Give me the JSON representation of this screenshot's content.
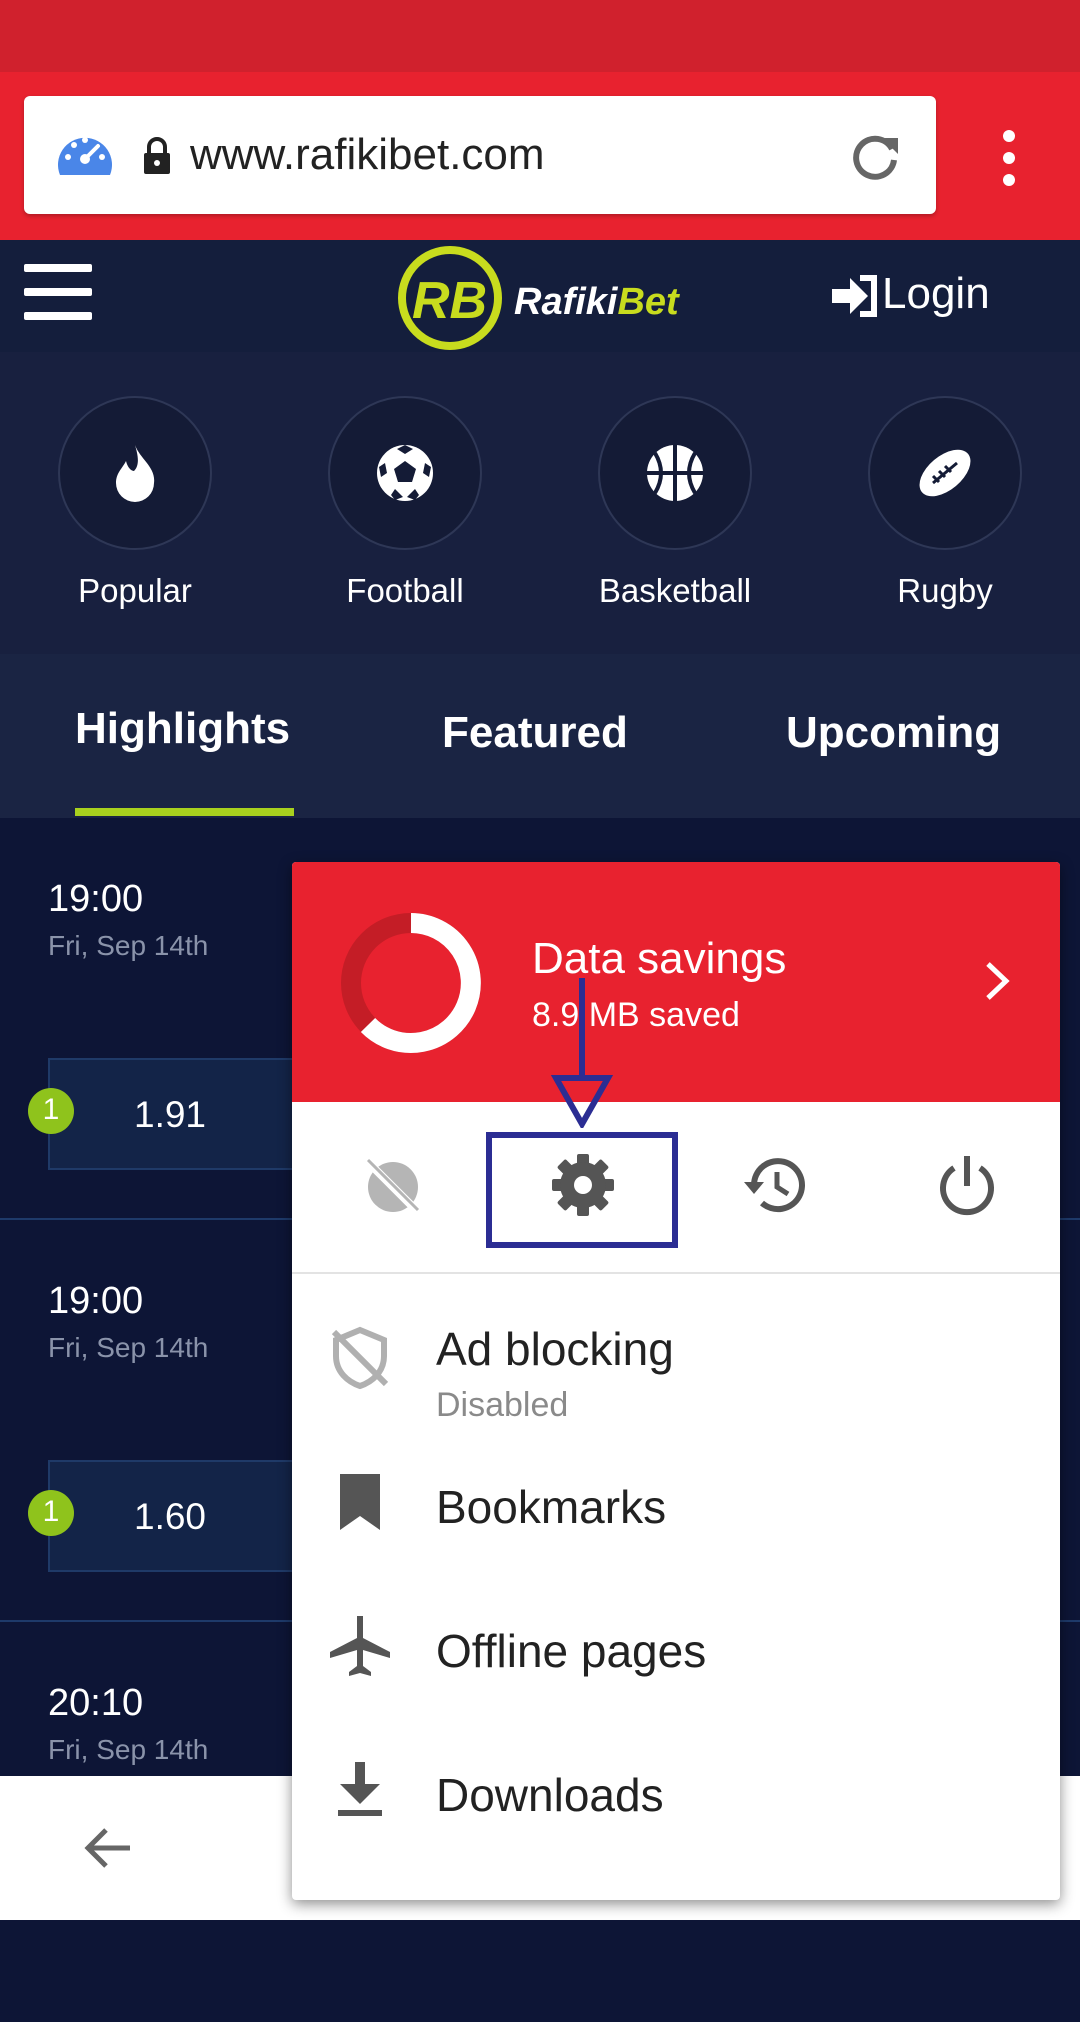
{
  "browser": {
    "url": "www.rafikibet.com",
    "icons": [
      "data-savings-speed-icon",
      "lock-icon",
      "reload-icon",
      "more-options-icon"
    ]
  },
  "site": {
    "brand": "RafikiBet",
    "logo_letters": "RB",
    "login_label": "Login",
    "sports": [
      {
        "label": "Popular",
        "icon": "fire-icon"
      },
      {
        "label": "Football",
        "icon": "football-icon"
      },
      {
        "label": "Basketball",
        "icon": "basketball-icon"
      },
      {
        "label": "Rugby",
        "icon": "rugby-ball-icon"
      }
    ],
    "tabs": [
      {
        "label": "Highlights",
        "active": true
      },
      {
        "label": "Featured",
        "active": false
      },
      {
        "label": "Upcoming",
        "active": false
      }
    ],
    "matches": [
      {
        "time": "19:00",
        "date": "Fri, Sep 14th",
        "badge": "1",
        "odd": "1.91"
      },
      {
        "time": "19:00",
        "date": "Fri, Sep 14th",
        "badge": "1",
        "odd": "1.60"
      },
      {
        "time": "20:10",
        "date": "Fri, Sep 14th"
      }
    ],
    "accent_color": "#a8d11e"
  },
  "menu": {
    "data_savings": {
      "title": "Data savings",
      "subtitle": "8.9 MB saved"
    },
    "icon_row": [
      "incognito-icon",
      "settings-icon",
      "history-icon",
      "power-icon"
    ],
    "items": [
      {
        "label": "Ad blocking",
        "sub": "Disabled",
        "icon": "ad-block-shield-icon"
      },
      {
        "label": "Bookmarks",
        "icon": "bookmark-icon"
      },
      {
        "label": "Offline pages",
        "icon": "airplane-icon"
      },
      {
        "label": "Downloads",
        "icon": "download-icon"
      }
    ],
    "highlight_color": "#2b2d93"
  }
}
